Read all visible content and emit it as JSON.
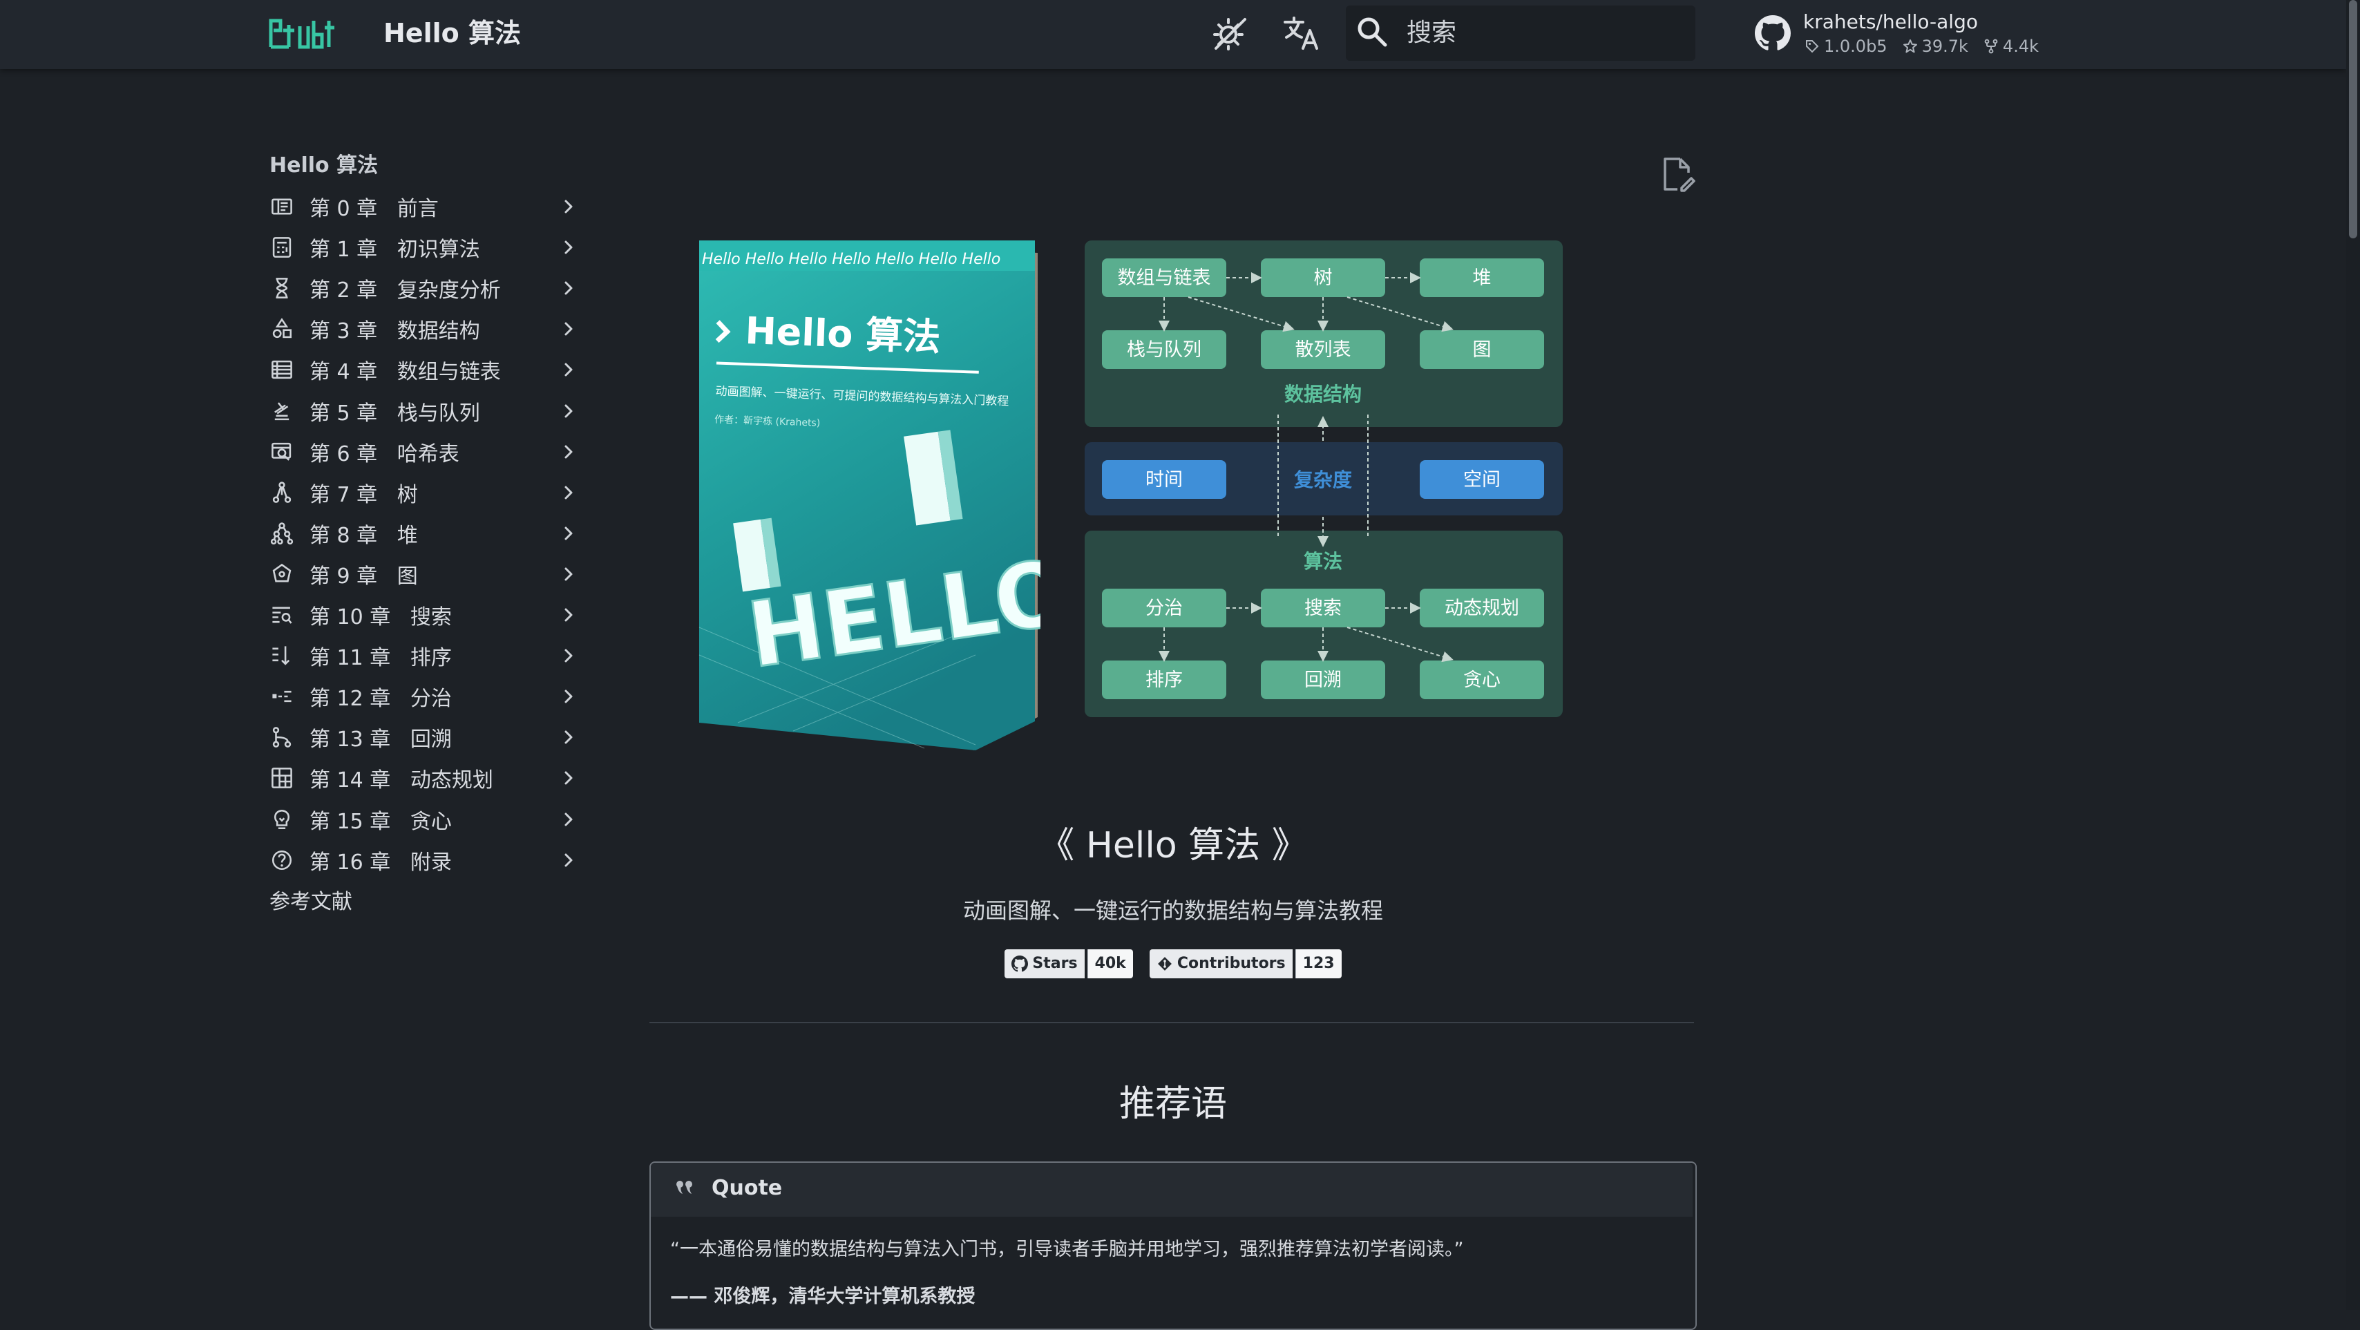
{
  "header": {
    "site_title": "Hello 算法",
    "search_placeholder": "搜索",
    "repo": {
      "name": "krahets/hello-algo",
      "version": "1.0.0b5",
      "stars": "39.7k",
      "forks": "4.4k"
    }
  },
  "nav": {
    "heading": "Hello 算法",
    "items": [
      {
        "label": "第 0 章   前言",
        "icon": "book-open-icon"
      },
      {
        "label": "第 1 章   初识算法",
        "icon": "calculator-icon"
      },
      {
        "label": "第 2 章   复杂度分析",
        "icon": "hourglass-icon"
      },
      {
        "label": "第 3 章   数据结构",
        "icon": "shapes-icon"
      },
      {
        "label": "第 4 章   数组与链表",
        "icon": "table-rows-icon"
      },
      {
        "label": "第 5 章   栈与队列",
        "icon": "stack-icon"
      },
      {
        "label": "第 6 章   哈希表",
        "icon": "table-search-icon"
      },
      {
        "label": "第 7 章   树",
        "icon": "tree-icon"
      },
      {
        "label": "第 8 章   堆",
        "icon": "heap-icon"
      },
      {
        "label": "第 9 章   图",
        "icon": "graph-icon"
      },
      {
        "label": "第 10 章   搜索",
        "icon": "text-search-icon"
      },
      {
        "label": "第 11 章   排序",
        "icon": "sort-icon"
      },
      {
        "label": "第 12 章   分治",
        "icon": "split-icon"
      },
      {
        "label": "第 13 章   回溯",
        "icon": "backtrack-icon"
      },
      {
        "label": "第 14 章   动态规划",
        "icon": "grid-icon"
      },
      {
        "label": "第 15 章   贪心",
        "icon": "lightbulb-icon"
      },
      {
        "label": "第 16 章   附录",
        "icon": "help-icon"
      }
    ],
    "references": "参考文献"
  },
  "hero": {
    "book_cover": {
      "strip": "Hello Hello Hello Hello Hello Hello Hello",
      "title": "Hello 算法",
      "subtitle": "动画图解、一键运行、可提问的数据结构与算法入门教程",
      "author": "作者：靳宇栋 (Krahets)",
      "art_text": "HELLO"
    },
    "diagram": {
      "ds_nodes": [
        "数组与链表",
        "树",
        "堆",
        "栈与队列",
        "散列表",
        "图"
      ],
      "ds_label": "数据结构",
      "complexity_nodes": [
        "时间",
        "空间"
      ],
      "complexity_label": "复杂度",
      "algo_label": "算法",
      "algo_nodes": [
        "分治",
        "搜索",
        "动态规划",
        "排序",
        "回溯",
        "贪心"
      ]
    },
    "title": "《 Hello 算法 》",
    "subtitle": "动画图解、一键运行的数据结构与算法教程",
    "badges": [
      {
        "label": "Stars",
        "value": "40k",
        "icon": "github-icon"
      },
      {
        "label": "Contributors",
        "value": "123",
        "icon": "git-icon"
      }
    ]
  },
  "recommend": {
    "title": "推荐语",
    "quote_label": "Quote",
    "quote_text": "“一本通俗易懂的数据结构与算法入门书，引导读者手脑并用地学习，强烈推荐算法初学者阅读。”",
    "quote_author": "—— 邓俊辉，清华大学计算机系教授"
  },
  "colors": {
    "background": "#1d2126",
    "header": "#22272e",
    "teal_node": "#5aae8f",
    "blue_node": "#3f8fd8",
    "teal_panel": "#2a4a44",
    "blue_panel": "#22344a"
  }
}
